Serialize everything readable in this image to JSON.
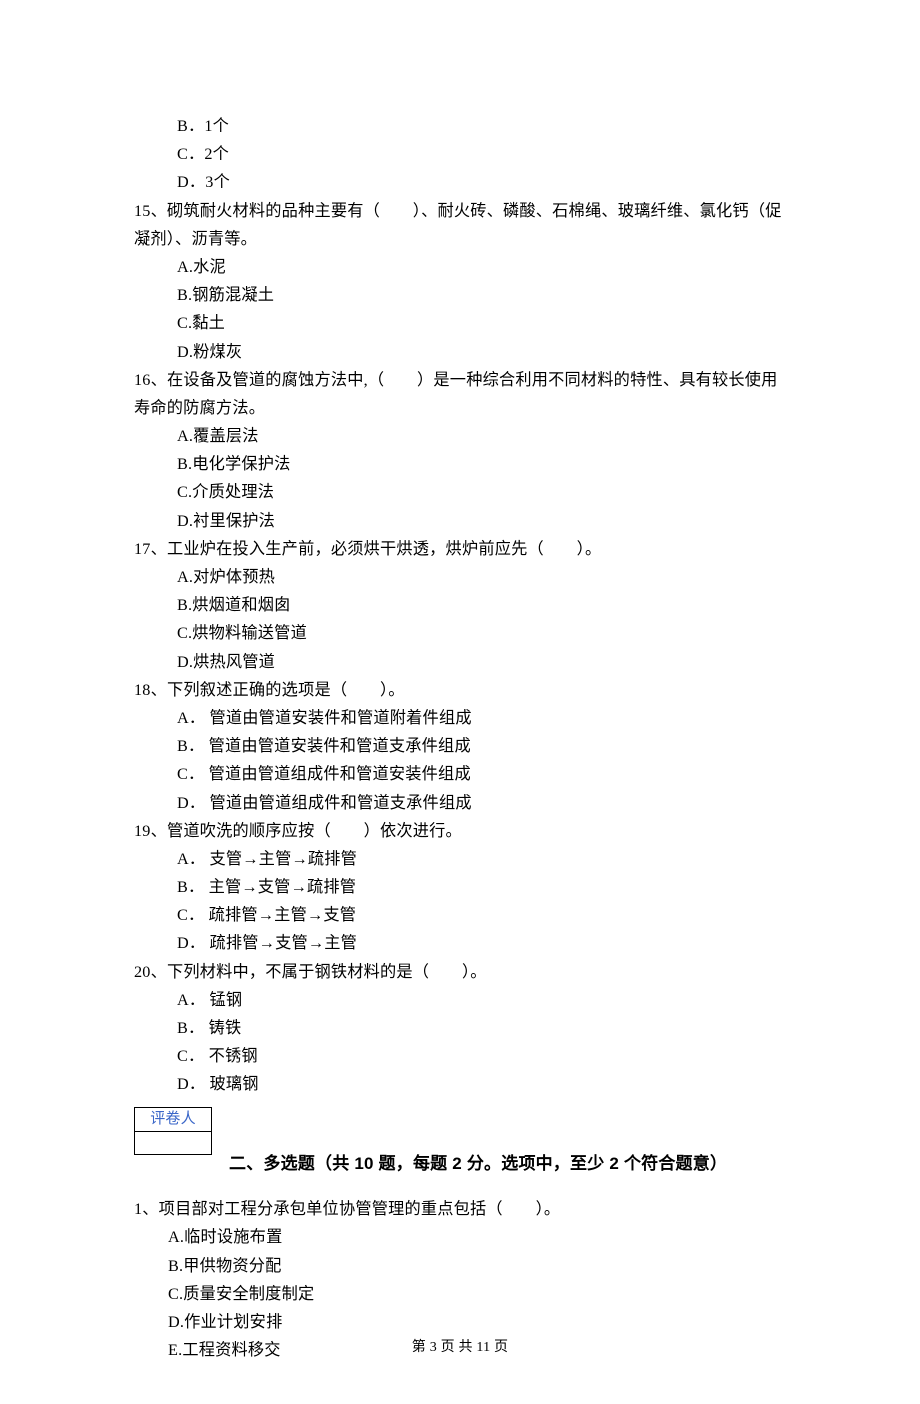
{
  "prev_options": {
    "b": "B．1个",
    "c": "C．2个",
    "d": "D．3个"
  },
  "questions": [
    {
      "num": "15",
      "stem": "15、砌筑耐火材料的品种主要有（　　）、耐火砖、磷酸、石棉绳、玻璃纤维、氯化钙（促凝剂）、沥青等。",
      "opts": [
        "A.水泥",
        "B.钢筋混凝土",
        "C.黏土",
        "D.粉煤灰"
      ]
    },
    {
      "num": "16",
      "stem": "16、在设备及管道的腐蚀方法中,（　　）是一种综合利用不同材料的特性、具有较长使用寿命的防腐方法。",
      "opts": [
        "A.覆盖层法",
        "B.电化学保护法",
        "C.介质处理法",
        "D.衬里保护法"
      ]
    },
    {
      "num": "17",
      "stem": "17、工业炉在投入生产前，必须烘干烘透，烘炉前应先（　　）。",
      "opts": [
        "A.对炉体预热",
        "B.烘烟道和烟囱",
        "C.烘物料输送管道",
        "D.烘热风管道"
      ]
    },
    {
      "num": "18",
      "stem": "18、下列叙述正确的选项是（　　）。",
      "opts": [
        "A． 管道由管道安装件和管道附着件组成",
        "B． 管道由管道安装件和管道支承件组成",
        "C． 管道由管道组成件和管道安装件组成",
        "D． 管道由管道组成件和管道支承件组成"
      ]
    },
    {
      "num": "19",
      "stem": "19、管道吹洗的顺序应按（　　）依次进行。",
      "opts": [
        "A． 支管→主管→疏排管",
        "B． 主管→支管→疏排管",
        "C． 疏排管→主管→支管",
        "D． 疏排管→支管→主管"
      ]
    },
    {
      "num": "20",
      "stem": "20、下列材料中，不属于钢铁材料的是（　　）。",
      "opts": [
        "A． 锰钢",
        "B． 铸铁",
        "C． 不锈钢",
        "D． 玻璃钢"
      ]
    }
  ],
  "grader_label": "评卷人",
  "section2": {
    "title": "二、多选题（共 10 题，每题 2 分。选项中，至少 2 个符合题意）"
  },
  "mc_questions": [
    {
      "num": "1",
      "stem": "1、项目部对工程分承包单位协管管理的重点包括（　　）。",
      "opts": [
        "A.临时设施布置",
        "B.甲供物资分配",
        "C.质量安全制度制定",
        "D.作业计划安排",
        "E.工程资料移交"
      ]
    }
  ],
  "footer": "第 3 页 共 11 页"
}
